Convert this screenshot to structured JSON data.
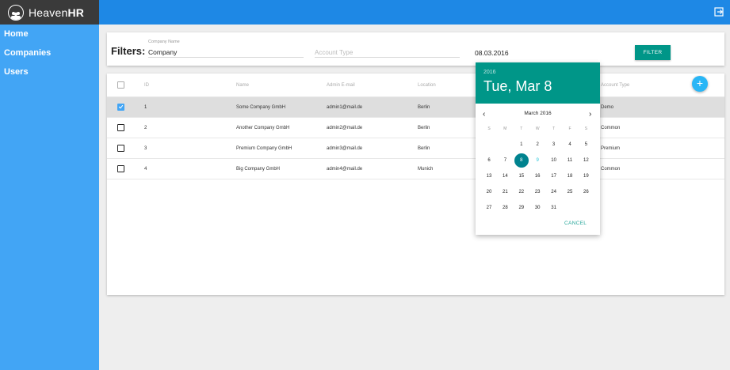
{
  "brand": {
    "name_light": "Heaven",
    "name_bold": "HR"
  },
  "sidebar": {
    "items": [
      {
        "label": "Home"
      },
      {
        "label": "Companies"
      },
      {
        "label": "Users"
      }
    ]
  },
  "filters": {
    "title": "Filters:",
    "company_name": {
      "label": "Company Name",
      "value": "Company"
    },
    "account_type": {
      "placeholder": "Account Type"
    },
    "date": {
      "value": "08.03.2016"
    },
    "filter_button": "FILTER"
  },
  "table": {
    "headers": {
      "id": "ID",
      "name": "Name",
      "email": "Admin E-mail",
      "location": "Location",
      "account_type": "Account Type"
    },
    "add_button": "+",
    "rows": [
      {
        "id": "1",
        "name": "Some Company GmbH",
        "email": "admin1@mail.de",
        "location": "Berlin",
        "account_type": "Demo",
        "checked": true
      },
      {
        "id": "2",
        "name": "Another Company GmbH",
        "email": "admin2@mail.de",
        "location": "Berlin",
        "account_type": "Common",
        "checked": false
      },
      {
        "id": "3",
        "name": "Premium Company GmbH",
        "email": "admin3@mail.de",
        "location": "Berlin",
        "account_type": "Premium",
        "checked": false
      },
      {
        "id": "4",
        "name": "Big Company GmbH",
        "email": "admin4@mail.de",
        "location": "Munich",
        "account_type": "Common",
        "checked": false
      }
    ]
  },
  "datepicker": {
    "year": "2016",
    "selected_label": "Tue, Mar 8",
    "month_label": "March 2016",
    "prev": "‹",
    "next": "›",
    "weekdays": [
      "S",
      "M",
      "T",
      "W",
      "T",
      "F",
      "S"
    ],
    "first_weekday_index": 2,
    "days_in_month": 31,
    "selected_day": 8,
    "today_day": 9,
    "cancel_label": "CANCEL"
  },
  "colors": {
    "topbar": "#1e88e5",
    "sidebar": "#42a5f5",
    "accent": "#009688",
    "selected_day": "#00838f",
    "fab": "#29b6f6"
  }
}
